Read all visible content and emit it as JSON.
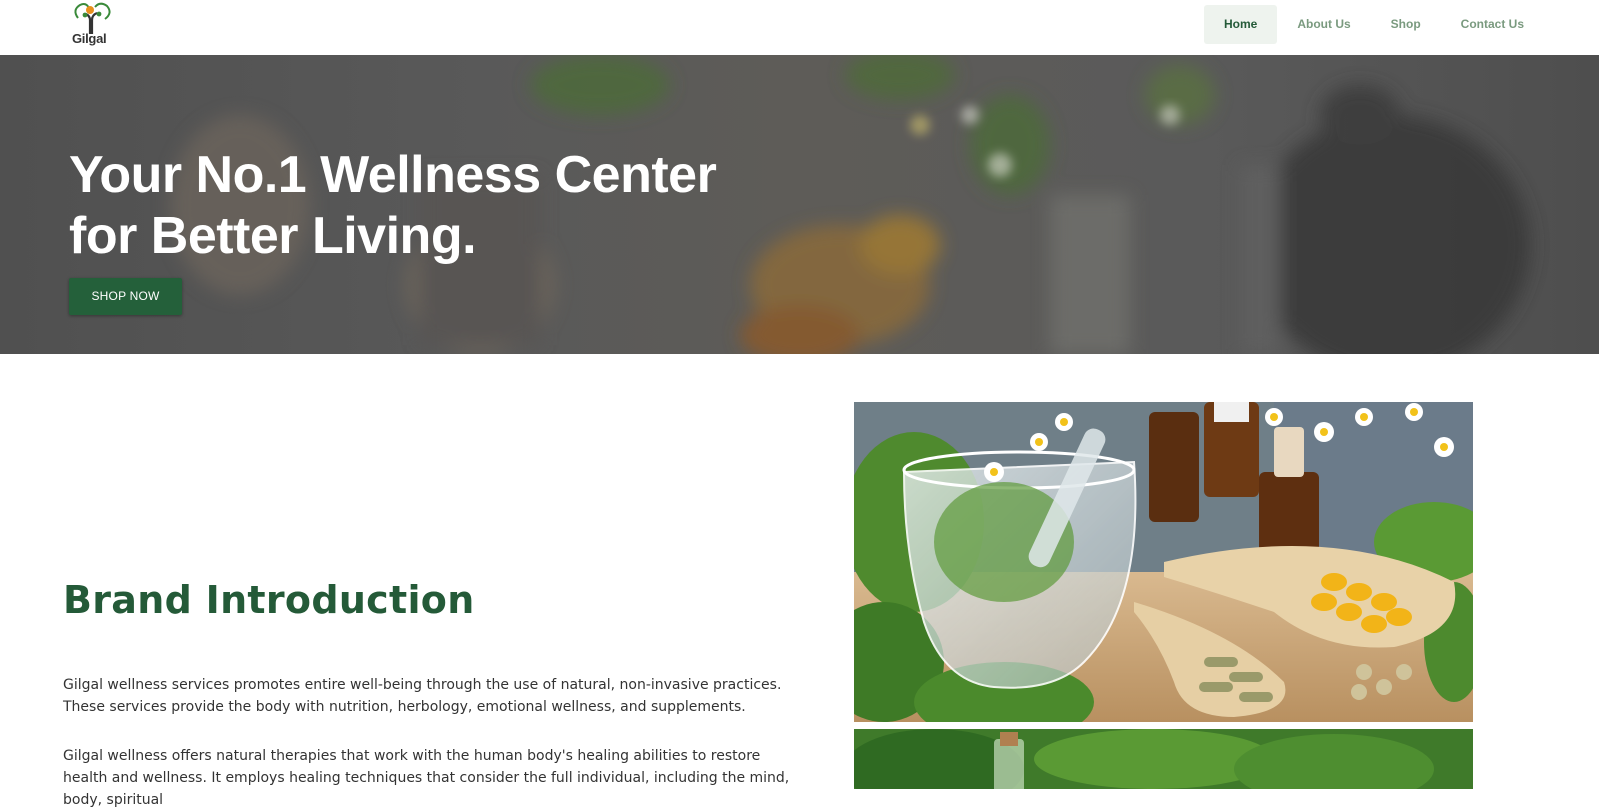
{
  "header": {
    "logo_text": "Gilgal",
    "nav": [
      {
        "label": "Home",
        "active": true
      },
      {
        "label": "About Us",
        "active": false
      },
      {
        "label": "Shop",
        "active": false
      },
      {
        "label": "Contact Us",
        "active": false
      }
    ]
  },
  "hero": {
    "title_line1": "Your No.1 Wellness Center",
    "title_line2": "for Better Living.",
    "cta_label": "SHOP NOW"
  },
  "intro": {
    "title": "Brand Introduction",
    "paragraph1": "Gilgal wellness services promotes entire well-being through the use of natural, non-invasive practices. These services provide the body with nutrition, herbology, emotional wellness, and supplements.",
    "paragraph2": "Gilgal wellness offers natural therapies that work with the human body's healing abilities to restore health and wellness. It employs healing techniques that consider the full individual, including the mind, body, spiritual"
  },
  "colors": {
    "brand_green": "#245a38",
    "nav_inactive": "#7a9a7f",
    "nav_active_bg": "#eef3ee"
  }
}
